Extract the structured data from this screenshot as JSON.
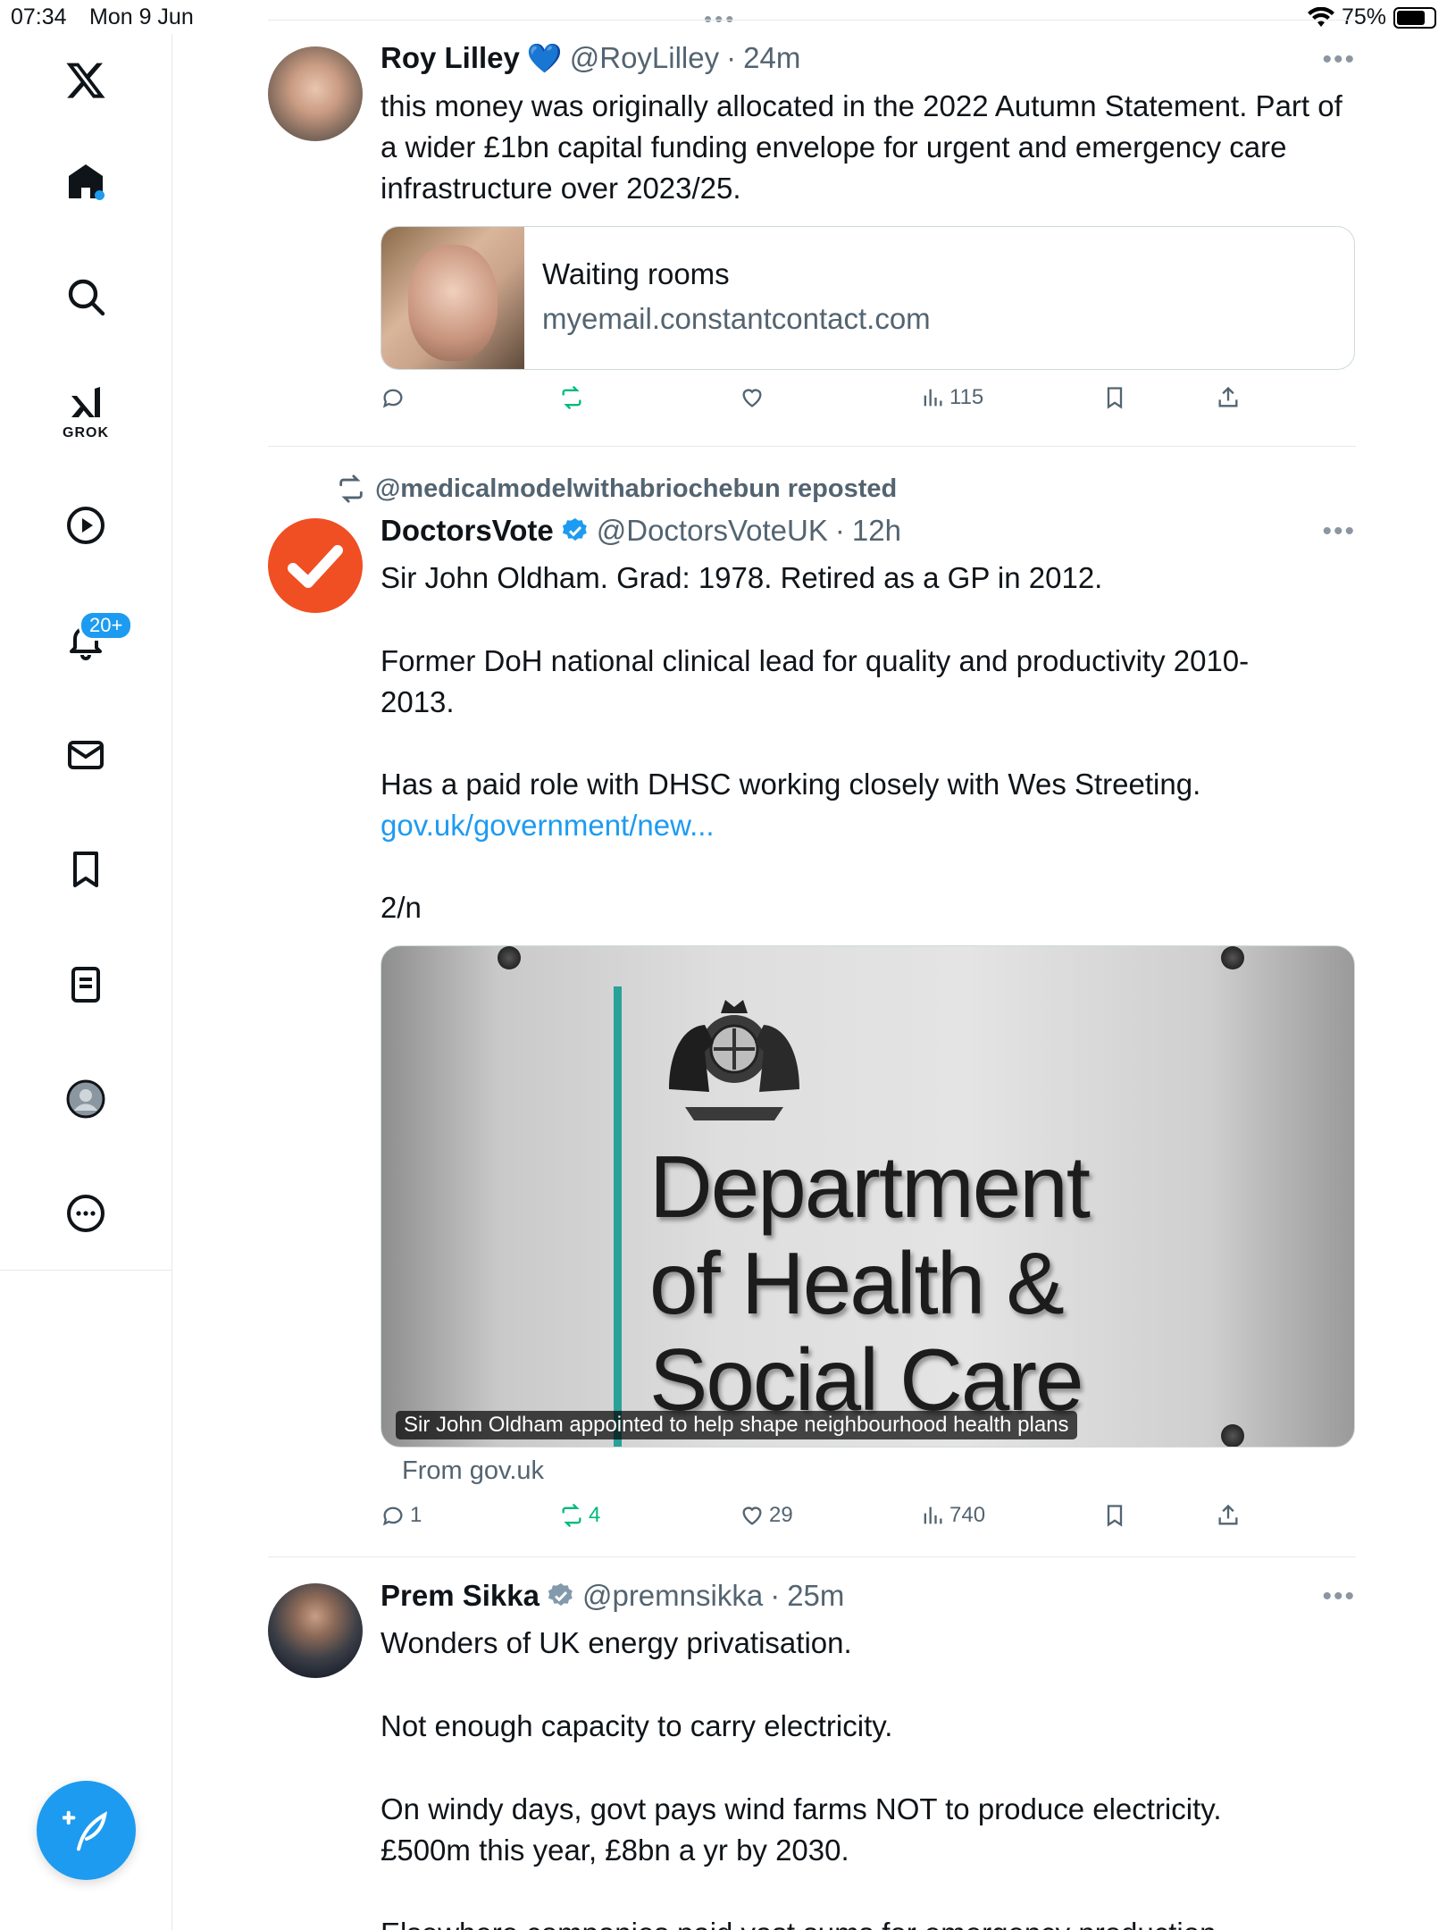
{
  "status_bar": {
    "time": "07:34",
    "date": "Mon 9 Jun",
    "battery": "75%"
  },
  "sidebar": {
    "items": [
      {
        "name": "x-logo"
      },
      {
        "name": "home"
      },
      {
        "name": "explore"
      },
      {
        "name": "grok",
        "label": "GROK"
      },
      {
        "name": "videos"
      },
      {
        "name": "notifications",
        "badge": "20+"
      },
      {
        "name": "messages"
      },
      {
        "name": "bookmarks"
      },
      {
        "name": "lists"
      },
      {
        "name": "profile"
      },
      {
        "name": "more"
      }
    ]
  },
  "colors": {
    "accent": "#1d9bf0",
    "retweet": "#00ba7c",
    "secondary_text": "#536471",
    "doctorsvote": "#f04e23"
  },
  "tweets": [
    {
      "display_name": "Roy Lilley",
      "emoji": "💙",
      "handle": "@RoyLilley",
      "time": "24m",
      "text": "this money was originally allocated in the 2022 Autumn Statement. Part of a wider £1bn capital funding envelope for urgent and emergency care infrastructure over 2023/25.",
      "card": {
        "title": "Waiting rooms",
        "domain": "myemail.constantcontact.com"
      },
      "stats": {
        "replies": "",
        "reposts": "",
        "likes": "",
        "views": "115"
      }
    },
    {
      "repost_by": "@medicalmodelwithabriochebun reposted",
      "display_name": "DoctorsVote",
      "handle": "@DoctorsVoteUK",
      "time": "12h",
      "para1": "Sir John Oldham. Grad: 1978. Retired as a GP in 2012.",
      "para2": "Former DoH national clinical lead for quality and productivity 2010-2013.",
      "para3": "Has a paid role with DHSC working closely with Wes Streeting.",
      "link": "gov.uk/government/new...",
      "para4": "2/n",
      "media": {
        "sign_line1": "Department",
        "sign_line2": "of Health &",
        "sign_line3": "Social Care",
        "caption": "Sir John Oldham appointed to help shape neighbourhood health plans",
        "source": "From gov.uk"
      },
      "stats": {
        "replies": "1",
        "reposts": "4",
        "likes": "29",
        "views": "740"
      }
    },
    {
      "display_name": "Prem Sikka",
      "handle": "@premnsikka",
      "time": "25m",
      "para1": "Wonders of UK energy privatisation.",
      "para2": "Not enough capacity to carry electricity.",
      "para3": "On windy days, govt pays wind farms NOT to produce electricity. £500m this year, £8bn a yr by 2030.",
      "para4": "Elsewhere companies paid vast sums for emergency production"
    }
  ]
}
